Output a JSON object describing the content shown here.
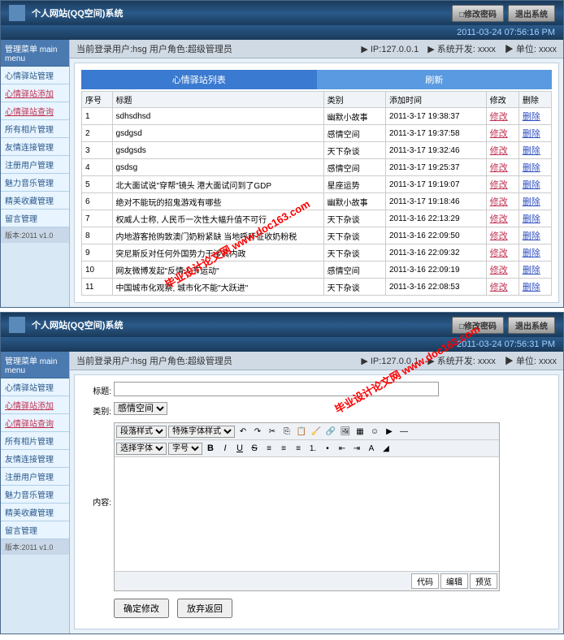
{
  "app_title": "个人网站(QQ空间)系统",
  "header_buttons": {
    "change_pw": "□修改密码",
    "exit": "退出系统"
  },
  "statusbar": {
    "time1": "2011-03-24 07:56:16 PM",
    "time2": "2011-03-24 07:56:31 PM"
  },
  "sidebar": {
    "header": "管理菜单 main menu",
    "items": [
      {
        "label": "心情驿站管理"
      },
      {
        "label": "心情驿站添加",
        "red": true
      },
      {
        "label": "心情驿站查询",
        "red": true
      },
      {
        "label": "所有相片管理"
      },
      {
        "label": "友情连接管理"
      },
      {
        "label": "注册用户管理"
      },
      {
        "label": "魅力音乐管理"
      },
      {
        "label": "精美收藏管理"
      },
      {
        "label": "留言管理"
      }
    ],
    "footer": "版本:2011 v1.0"
  },
  "infobar": {
    "left": "当前登录用户:hsg 用户角色:超级管理员",
    "right": "▶ IP:127.0.0.1　▶ 系统开发: xxxx　▶ 单位: xxxx"
  },
  "listview": {
    "tab1": "心情驿站列表",
    "tab2": "刷新",
    "cols": {
      "no": "序号",
      "title": "标题",
      "cat": "类别",
      "time": "添加时间",
      "edit": "修改",
      "del": "删除"
    },
    "edit_label": "修改",
    "del_label": "删除",
    "rows": [
      {
        "no": "1",
        "title": "sdhsdhsd",
        "cat": "幽默小故事",
        "time": "2011-3-17 19:38:37"
      },
      {
        "no": "2",
        "title": "gsdgsd",
        "cat": "感情空间",
        "time": "2011-3-17 19:37:58"
      },
      {
        "no": "3",
        "title": "gsdgsds",
        "cat": "天下杂谈",
        "time": "2011-3-17 19:32:46"
      },
      {
        "no": "4",
        "title": "gsdsg",
        "cat": "感情空间",
        "time": "2011-3-17 19:25:37"
      },
      {
        "no": "5",
        "title": "北大面试说\"穿帮\"镜头 港大面试问到了GDP",
        "cat": "星座运势",
        "time": "2011-3-17 19:19:07"
      },
      {
        "no": "6",
        "title": "绝对不能玩的招鬼游戏有哪些",
        "cat": "幽默小故事",
        "time": "2011-3-17 19:18:46"
      },
      {
        "no": "7",
        "title": "权威人士称, 人民币一次性大幅升值不可行",
        "cat": "天下杂谈",
        "time": "2011-3-16 22:13:29"
      },
      {
        "no": "8",
        "title": "内地游客抢购致澳门奶粉紧缺 当地呼吁征收奶粉税",
        "cat": "天下杂谈",
        "time": "2011-3-16 22:09:50"
      },
      {
        "no": "9",
        "title": "突尼斯反对任何外国势力干涉其内政",
        "cat": "天下杂谈",
        "time": "2011-3-16 22:09:32"
      },
      {
        "no": "10",
        "title": "网友微博发起\"反情人节运动\"",
        "cat": "感情空间",
        "time": "2011-3-16 22:09:19"
      },
      {
        "no": "11",
        "title": "中国城市化观察, 城市化不能\"大跃进\"",
        "cat": "天下杂谈",
        "time": "2011-3-16 22:08:53"
      }
    ]
  },
  "form": {
    "title_label": "标题:",
    "cat_label": "类别:",
    "cat_value": "感情空间",
    "content_label": "内容:",
    "para_style": "段落样式",
    "font_style": "特殊字体样式",
    "font_sel": "选择字体",
    "size_sel": "字号",
    "tabs": {
      "code": "代码",
      "edit": "编辑",
      "preview": "预览"
    },
    "submit": "确定修改",
    "reset": "放弃返回"
  },
  "watermark": "毕业设计论文网\nwww.doc163.com"
}
